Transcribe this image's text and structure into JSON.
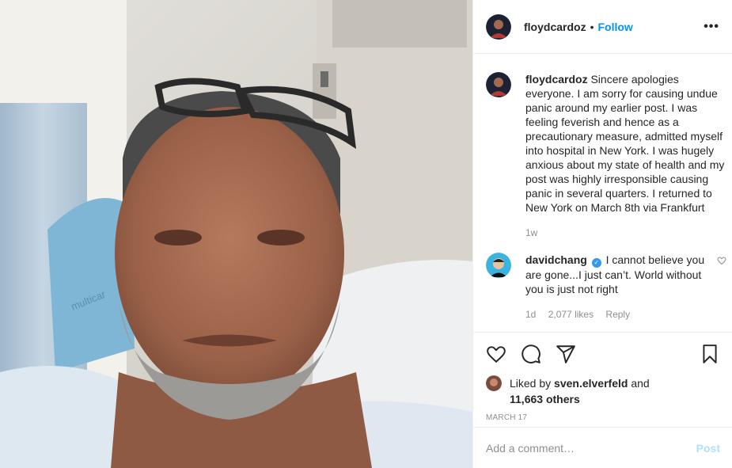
{
  "post": {
    "author": "floydcardoz",
    "separator": "•",
    "follow_label": "Follow",
    "more_label": "•••"
  },
  "comments": [
    {
      "username": "floydcardoz",
      "text": "Sincere apologies everyone. I am sorry for causing undue panic around my earlier post. I was feeling feverish and hence as a precautionary measure, admitted myself into hospital in New York. I was hugely anxious about my state of health and my post was highly irresponsible causing panic in several quarters. I returned to New York on March 8th via Frankfurt",
      "time": "1w"
    },
    {
      "username": "davidchang",
      "verified": "✓",
      "text": "I cannot believe you are gone...I just can’t. World without you is just not right",
      "time": "1d",
      "likes": "2,077 likes",
      "reply": "Reply"
    }
  ],
  "likes": {
    "prefix": "Liked by",
    "user": "sven.elverfeld",
    "conj": "and",
    "others": "11,663 others"
  },
  "date": "MARCH 17",
  "add_comment": {
    "placeholder": "Add a comment…",
    "post_label": "Post"
  },
  "photo": {
    "wall_text": "multicar"
  },
  "icons": {
    "like": "heart-icon",
    "comment": "comment-icon",
    "share": "share-icon",
    "save": "bookmark-icon"
  },
  "colors": {
    "link": "#0095f6",
    "post_disabled": "#b2dffc",
    "muted": "#8e8e8e",
    "verified": "#3897f0"
  }
}
